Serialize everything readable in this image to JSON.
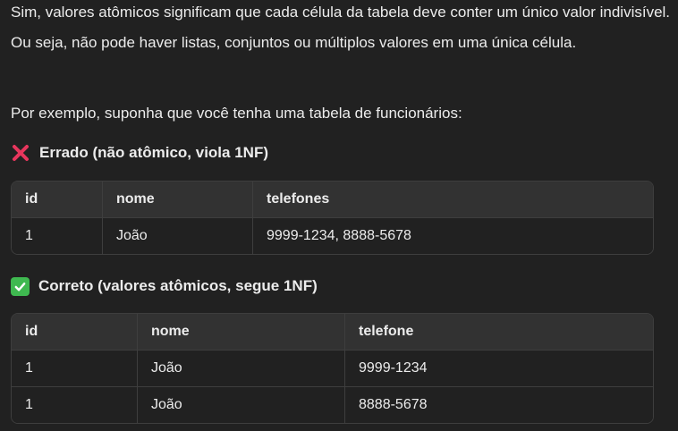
{
  "intro": {
    "paragraph1": "Sim, valores atômicos significam que cada célula da tabela deve conter um único valor indivisível. Ou seja, não pode haver listas, conjuntos ou múltiplos valores em uma única célula.",
    "paragraph2": "Por exemplo, suponha que você tenha uma tabela de funcionários:"
  },
  "wrong_example": {
    "icon": "cross-mark-icon",
    "icon_color": "#e8365d",
    "heading": "Errado (não atômico, viola 1NF)",
    "table": {
      "headers": [
        "id",
        "nome",
        "telefones"
      ],
      "rows": [
        [
          "1",
          "João",
          "9999-1234, 8888-5678"
        ]
      ]
    }
  },
  "correct_example": {
    "icon": "check-mark-icon",
    "icon_color": "#3fb950",
    "heading": "Correto (valores atômicos, segue 1NF)",
    "table": {
      "headers": [
        "id",
        "nome",
        "telefone"
      ],
      "rows": [
        [
          "1",
          "João",
          "9999-1234"
        ],
        [
          "1",
          "João",
          "8888-5678"
        ]
      ]
    }
  }
}
